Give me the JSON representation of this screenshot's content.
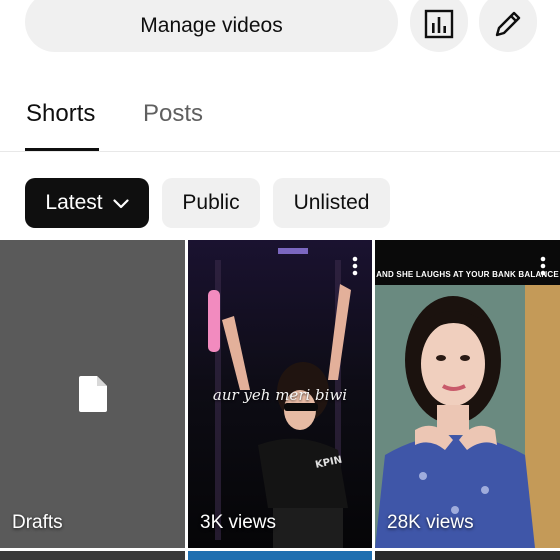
{
  "header": {
    "manage_videos_label": "Manage videos",
    "analytics_icon": "bar-chart-icon",
    "edit_icon": "pencil-icon"
  },
  "tabs": [
    {
      "label": "Shorts",
      "active": true
    },
    {
      "label": "Posts",
      "active": false
    }
  ],
  "filters": {
    "latest": {
      "label": "Latest",
      "selected": true,
      "icon": "chevron-down-icon"
    },
    "public": {
      "label": "Public"
    },
    "unlisted": {
      "label": "Unlisted"
    }
  },
  "grid": {
    "drafts": {
      "label": "Drafts",
      "icon": "file-icon"
    },
    "items": [
      {
        "views": "3K views",
        "overlay_text": "aur yeh meri biwi"
      },
      {
        "views": "28K views",
        "caption": "AND SHE LAUGHS AT YOUR BANK BALANCE"
      }
    ]
  },
  "colors": {
    "chip_selected_bg": "#0f0f0f",
    "chip_bg": "#f0f0f0",
    "drafts_bg": "#5a5a5a",
    "muted_text": "#606060"
  }
}
